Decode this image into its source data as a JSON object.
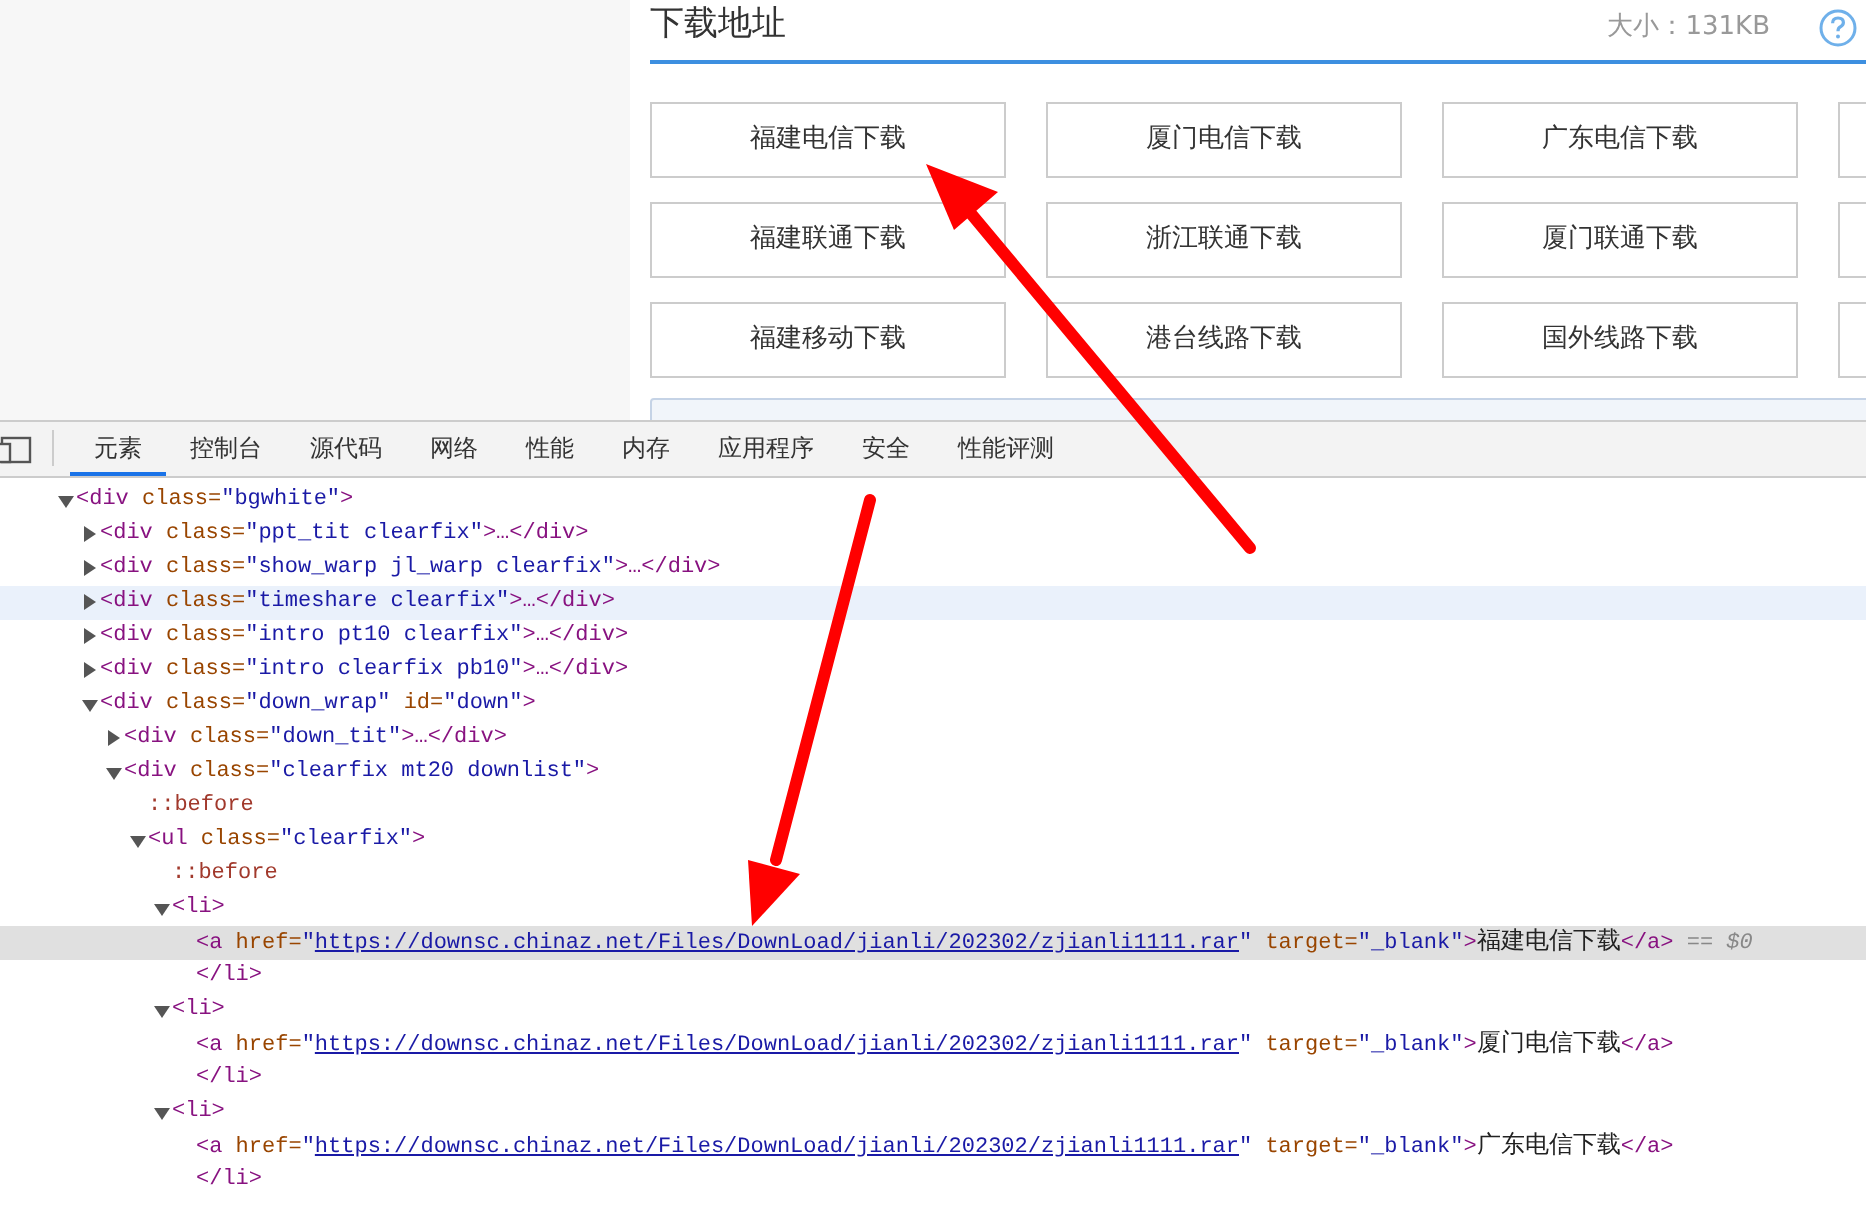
{
  "download_section": {
    "title": "下载地址",
    "size": "大小：131KB",
    "buttons": [
      {
        "label": "福建电信下载"
      },
      {
        "label": "厦门电信下载"
      },
      {
        "label": "广东电信下载"
      },
      {
        "label": "福建联通下载"
      },
      {
        "label": "浙江联通下载"
      },
      {
        "label": "厦门联通下载"
      },
      {
        "label": "福建移动下载"
      },
      {
        "label": "港台线路下载"
      },
      {
        "label": "国外线路下载"
      }
    ],
    "cut_column": true
  },
  "devtools": {
    "tabs": [
      {
        "label": "元素",
        "selected": true
      },
      {
        "label": "控制台",
        "selected": false
      },
      {
        "label": "源代码",
        "selected": false
      },
      {
        "label": "网络",
        "selected": false
      },
      {
        "label": "性能",
        "selected": false
      },
      {
        "label": "内存",
        "selected": false
      },
      {
        "label": "应用程序",
        "selected": false
      },
      {
        "label": "安全",
        "selected": false
      },
      {
        "label": "性能评测",
        "selected": false
      }
    ],
    "tree": [
      {
        "expanded": true,
        "selected": false,
        "hovered": false,
        "tokens": [
          {
            "kind": "tag",
            "text": "<div"
          },
          {
            "kind": "attr",
            "text": "class="
          },
          {
            "kind": "value",
            "text": "\"bgwhite\""
          },
          {
            "kind": "tag",
            "text": ">"
          }
        ],
        "children": [
          {
            "expanded": false,
            "selected": false,
            "hovered": false,
            "tokens": [
              {
                "kind": "tag",
                "text": "<div"
              },
              {
                "kind": "attr",
                "text": "class="
              },
              {
                "kind": "value",
                "text": "\"ppt_tit clearfix\""
              },
              {
                "kind": "tag",
                "text": ">…</div>"
              }
            ]
          },
          {
            "expanded": false,
            "selected": false,
            "hovered": false,
            "tokens": [
              {
                "kind": "tag",
                "text": "<div"
              },
              {
                "kind": "attr",
                "text": "class="
              },
              {
                "kind": "value",
                "text": "\"show_warp jl_warp clearfix\""
              },
              {
                "kind": "tag",
                "text": ">…</div>"
              }
            ]
          },
          {
            "expanded": false,
            "selected": false,
            "hovered": true,
            "tokens": [
              {
                "kind": "tag",
                "text": "<div"
              },
              {
                "kind": "attr",
                "text": "class="
              },
              {
                "kind": "value",
                "text": "\"timeshare clearfix\""
              },
              {
                "kind": "tag",
                "text": ">…</div>"
              }
            ]
          },
          {
            "expanded": false,
            "selected": false,
            "hovered": false,
            "tokens": [
              {
                "kind": "tag",
                "text": "<div"
              },
              {
                "kind": "attr",
                "text": "class="
              },
              {
                "kind": "value",
                "text": "\"intro pt10 clearfix\""
              },
              {
                "kind": "tag",
                "text": ">…</div>"
              }
            ]
          },
          {
            "expanded": false,
            "selected": false,
            "hovered": false,
            "tokens": [
              {
                "kind": "tag",
                "text": "<div"
              },
              {
                "kind": "attr",
                "text": "class="
              },
              {
                "kind": "value",
                "text": "\"intro clearfix pb10\""
              },
              {
                "kind": "tag",
                "text": ">…</div>"
              }
            ]
          },
          {
            "expanded": true,
            "selected": false,
            "hovered": false,
            "tokens": [
              {
                "kind": "tag",
                "text": "<div"
              },
              {
                "kind": "attr",
                "text": "class="
              },
              {
                "kind": "value",
                "text": "\"down_wrap\""
              },
              {
                "kind": "attr",
                "text": "id="
              },
              {
                "kind": "value",
                "text": "\"down\""
              },
              {
                "kind": "tag",
                "text": ">"
              }
            ],
            "children": [
              {
                "expanded": false,
                "selected": false,
                "hovered": false,
                "tokens": [
                  {
                    "kind": "tag",
                    "text": "<div"
                  },
                  {
                    "kind": "attr",
                    "text": "class="
                  },
                  {
                    "kind": "value",
                    "text": "\"down_tit\""
                  },
                  {
                    "kind": "tag",
                    "text": ">…</div>"
                  }
                ]
              },
              {
                "expanded": true,
                "selected": false,
                "hovered": false,
                "tokens": [
                  {
                    "kind": "tag",
                    "text": "<div"
                  },
                  {
                    "kind": "attr",
                    "text": "class="
                  },
                  {
                    "kind": "value",
                    "text": "\"clearfix mt20 downlist\""
                  },
                  {
                    "kind": "tag",
                    "text": ">"
                  }
                ],
                "children": [
                  {
                    "selected": false,
                    "hovered": false,
                    "tokens": [
                      {
                        "kind": "pseudo",
                        "text": "::before"
                      }
                    ]
                  },
                  {
                    "expanded": true,
                    "selected": false,
                    "hovered": false,
                    "tokens": [
                      {
                        "kind": "tag",
                        "text": "<ul"
                      },
                      {
                        "kind": "attr",
                        "text": "class="
                      },
                      {
                        "kind": "value",
                        "text": "\"clearfix\""
                      },
                      {
                        "kind": "tag",
                        "text": ">"
                      }
                    ],
                    "children": [
                      {
                        "selected": false,
                        "hovered": false,
                        "tokens": [
                          {
                            "kind": "pseudo",
                            "text": "::before"
                          }
                        ]
                      },
                      {
                        "expanded": true,
                        "selected": false,
                        "hovered": false,
                        "tokens": [
                          {
                            "kind": "tag",
                            "text": "<li>"
                          }
                        ],
                        "children": [
                          {
                            "selected": true,
                            "hovered": false,
                            "tokens": [
                              {
                                "kind": "tag",
                                "text": "<a"
                              },
                              {
                                "kind": "attr",
                                "text": "href="
                              },
                              {
                                "kind": "value",
                                "text": "\""
                              },
                              {
                                "kind": "link",
                                "text": "https://downsc.chinaz.net/Files/DownLoad/jianli/202302/zjianli1111.rar"
                              },
                              {
                                "kind": "value",
                                "text": "\""
                              },
                              {
                                "kind": "attr",
                                "text": "target="
                              },
                              {
                                "kind": "value",
                                "text": "\"_blank\""
                              },
                              {
                                "kind": "tag",
                                "text": ">"
                              },
                              {
                                "kind": "content",
                                "text": "福建电信下载"
                              },
                              {
                                "kind": "tag",
                                "text": "</a>"
                              },
                              {
                                "kind": "ref",
                                "text": "== $0"
                              }
                            ]
                          },
                          {
                            "selected": false,
                            "hovered": false,
                            "tokens": [
                              {
                                "kind": "tag",
                                "text": "</li>"
                              }
                            ]
                          }
                        ]
                      },
                      {
                        "expanded": true,
                        "selected": false,
                        "hovered": false,
                        "tokens": [
                          {
                            "kind": "tag",
                            "text": "<li>"
                          }
                        ],
                        "children": [
                          {
                            "selected": false,
                            "hovered": false,
                            "tokens": [
                              {
                                "kind": "tag",
                                "text": "<a"
                              },
                              {
                                "kind": "attr",
                                "text": "href="
                              },
                              {
                                "kind": "value",
                                "text": "\""
                              },
                              {
                                "kind": "link",
                                "text": "https://downsc.chinaz.net/Files/DownLoad/jianli/202302/zjianli1111.rar"
                              },
                              {
                                "kind": "value",
                                "text": "\""
                              },
                              {
                                "kind": "attr",
                                "text": "target="
                              },
                              {
                                "kind": "value",
                                "text": "\"_blank\""
                              },
                              {
                                "kind": "tag",
                                "text": ">"
                              },
                              {
                                "kind": "content",
                                "text": "厦门电信下载"
                              },
                              {
                                "kind": "tag",
                                "text": "</a>"
                              }
                            ]
                          },
                          {
                            "selected": false,
                            "hovered": false,
                            "tokens": [
                              {
                                "kind": "tag",
                                "text": "</li>"
                              }
                            ]
                          }
                        ]
                      },
                      {
                        "expanded": true,
                        "selected": false,
                        "hovered": false,
                        "tokens": [
                          {
                            "kind": "tag",
                            "text": "<li>"
                          }
                        ],
                        "children": [
                          {
                            "selected": false,
                            "hovered": false,
                            "tokens": [
                              {
                                "kind": "tag",
                                "text": "<a"
                              },
                              {
                                "kind": "attr",
                                "text": "href="
                              },
                              {
                                "kind": "value",
                                "text": "\""
                              },
                              {
                                "kind": "link",
                                "text": "https://downsc.chinaz.net/Files/DownLoad/jianli/202302/zjianli1111.rar"
                              },
                              {
                                "kind": "value",
                                "text": "\""
                              },
                              {
                                "kind": "attr",
                                "text": "target="
                              },
                              {
                                "kind": "value",
                                "text": "\"_blank\""
                              },
                              {
                                "kind": "tag",
                                "text": ">"
                              },
                              {
                                "kind": "content",
                                "text": "广东电信下载"
                              },
                              {
                                "kind": "tag",
                                "text": "</a>"
                              }
                            ]
                          },
                          {
                            "selected": false,
                            "hovered": false,
                            "tokens": [
                              {
                                "kind": "tag",
                                "text": "</li>"
                              }
                            ]
                          }
                        ]
                      }
                    ]
                  }
                ]
              }
            ]
          }
        ]
      }
    ]
  }
}
